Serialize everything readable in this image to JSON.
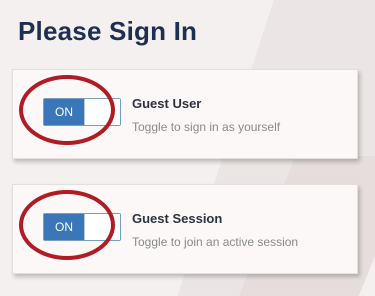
{
  "page": {
    "title": "Please Sign In"
  },
  "options": [
    {
      "toggle_state": "ON",
      "title": "Guest User",
      "description": "Toggle to sign in as yourself"
    },
    {
      "toggle_state": "ON",
      "title": "Guest Session",
      "description": "Toggle to join an active session"
    }
  ],
  "colors": {
    "title": "#1f2f4f",
    "toggle_on": "#3a77b8",
    "highlight_ring": "#b01b24",
    "card_background": "#fbf8f7"
  }
}
